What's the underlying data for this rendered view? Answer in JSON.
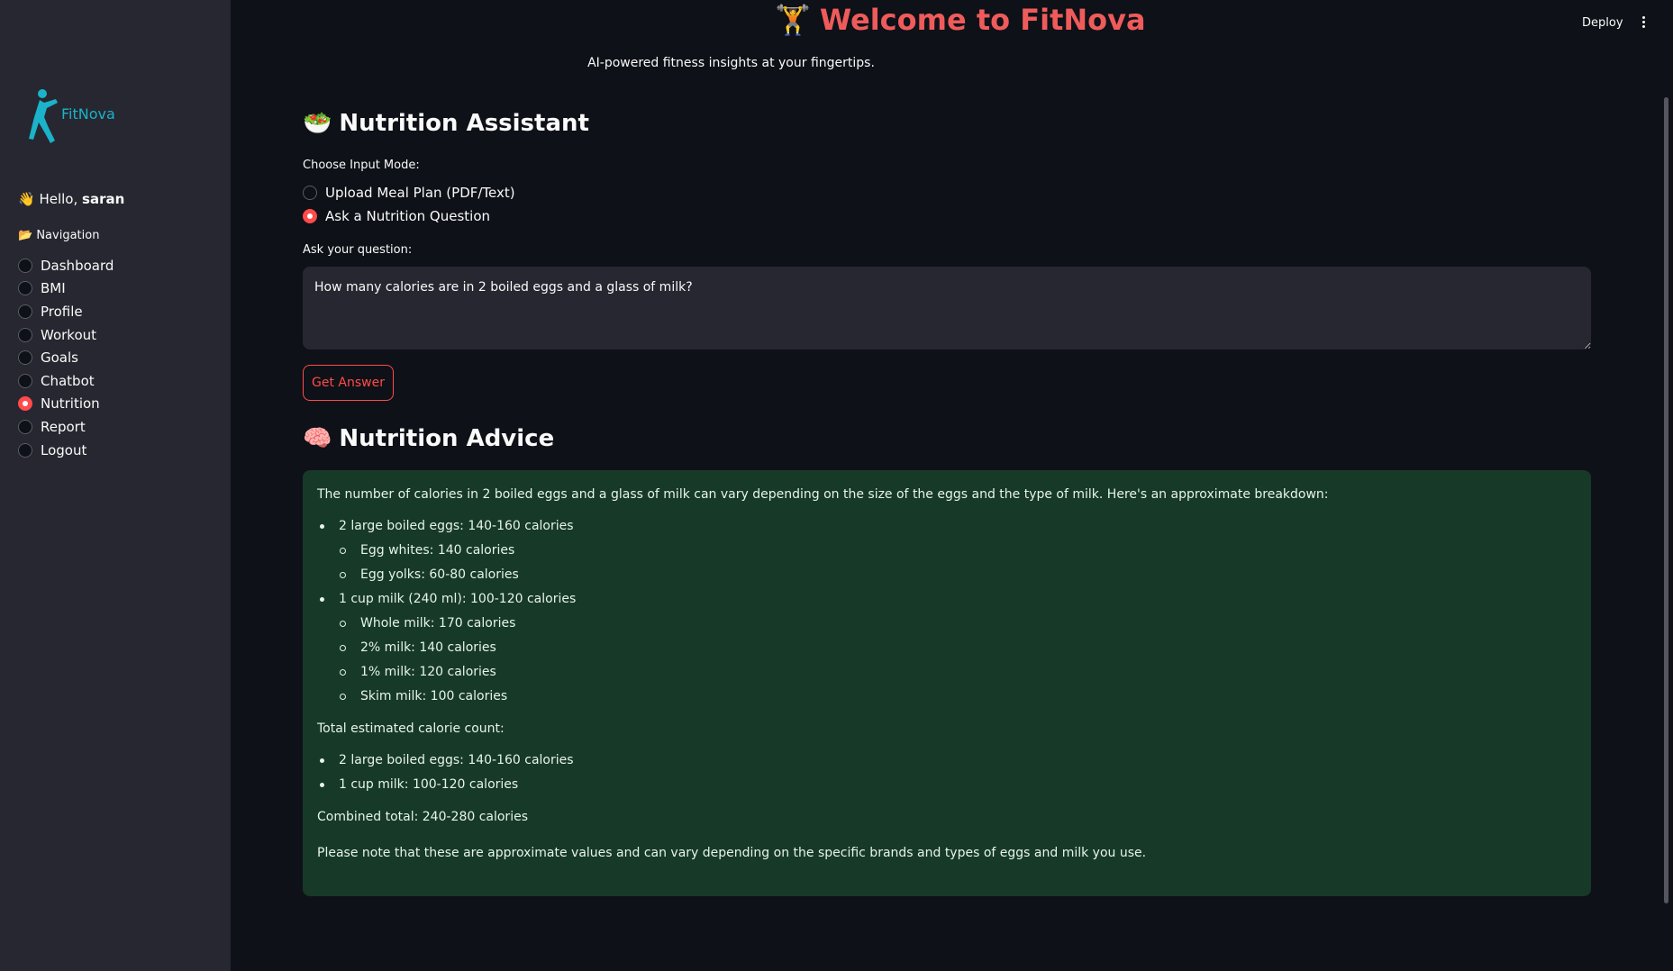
{
  "header": {
    "title": "Welcome to FitNova",
    "tagline": "AI-powered fitness insights at your fingertips.",
    "deploy_label": "Deploy"
  },
  "sidebar": {
    "logo_text": "FitNova",
    "greeting": "Hello,",
    "user_name": "saran",
    "nav_heading": "Navigation",
    "items": [
      {
        "label": "Dashboard",
        "selected": false
      },
      {
        "label": "BMI",
        "selected": false
      },
      {
        "label": "Profile",
        "selected": false
      },
      {
        "label": "Workout",
        "selected": false
      },
      {
        "label": "Goals",
        "selected": false
      },
      {
        "label": "Chatbot",
        "selected": false
      },
      {
        "label": "Nutrition",
        "selected": true
      },
      {
        "label": "Report",
        "selected": false
      },
      {
        "label": "Logout",
        "selected": false
      }
    ]
  },
  "nutrition": {
    "title": "Nutrition Assistant",
    "mode_label": "Choose Input Mode:",
    "modes": [
      {
        "label": "Upload Meal Plan (PDF/Text)",
        "selected": false
      },
      {
        "label": "Ask a Nutrition Question",
        "selected": true
      }
    ],
    "question_label": "Ask your question:",
    "question_value": "How many calories are in 2 boiled eggs and a glass of milk?",
    "button_label": "Get Answer"
  },
  "advice": {
    "title": "Nutrition Advice",
    "intro": "The number of calories in 2 boiled eggs and a glass of milk can vary depending on the size of the eggs and the type of milk. Here's an approximate breakdown:",
    "eggs": "2 large boiled eggs: 140-160 calories",
    "egg_whites": "Egg whites: 140 calories",
    "egg_yolks": "Egg yolks: 60-80 calories",
    "milk": "1 cup milk (240 ml): 100-120 calories",
    "whole_milk": "Whole milk: 170 calories",
    "two_pct_milk": "2% milk: 140 calories",
    "one_pct_milk": "1% milk: 120 calories",
    "skim_milk": "Skim milk: 100 calories",
    "total_heading": "Total estimated calorie count:",
    "total_eggs": "2 large boiled eggs: 140-160 calories",
    "total_milk": "1 cup milk: 100-120 calories",
    "combined": "Combined total: 240-280 calories",
    "note": "Please note that these are approximate values and can vary depending on the specific brands and types of eggs and milk you use."
  },
  "colors": {
    "accent": "#ff4b4b",
    "title": "#ef5b5b",
    "logo": "#1ab3c9",
    "advice_bg": "#173928",
    "sidebar_bg": "#262730",
    "app_bg": "#0e1117"
  }
}
